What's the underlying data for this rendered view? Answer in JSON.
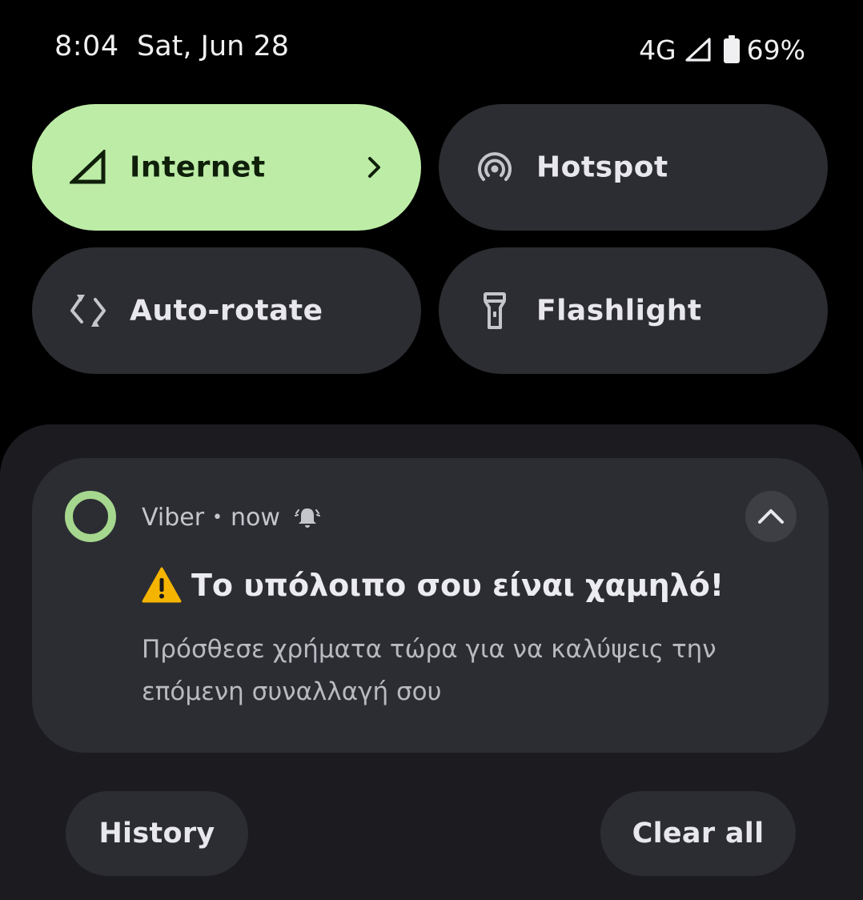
{
  "status_bar": {
    "time": "8:04",
    "date": "Sat, Jun 28",
    "network": "4G",
    "battery": "69%",
    "icons": [
      "cell-signal-icon",
      "battery-icon"
    ]
  },
  "quick_settings": {
    "tiles": [
      {
        "label": "Internet",
        "icon": "cell-signal-icon",
        "active": true,
        "has_chevron": true
      },
      {
        "label": "Hotspot",
        "icon": "hotspot-icon",
        "active": false
      },
      {
        "label": "Auto-rotate",
        "icon": "auto-rotate-icon",
        "active": false
      },
      {
        "label": "Flashlight",
        "icon": "flashlight-icon",
        "active": false
      }
    ]
  },
  "notification": {
    "app": "Viber",
    "separator": "•",
    "time": "now",
    "title_icon": "warning-icon",
    "title": "Το υπόλοιπο σου είναι χαμηλό!",
    "body": "Πρόσθεσε χρήματα τώρα για να καλύψεις την επόμενη συναλλαγή σου"
  },
  "actions": {
    "history": "History",
    "clear_all": "Clear all"
  },
  "colors": {
    "background": "#000000",
    "shade": "#1b1b20",
    "tile": "#2c2d32",
    "tile_active": "#bdeca6",
    "app_icon_ring": "#a5d78e",
    "warning": "#f5b400"
  }
}
